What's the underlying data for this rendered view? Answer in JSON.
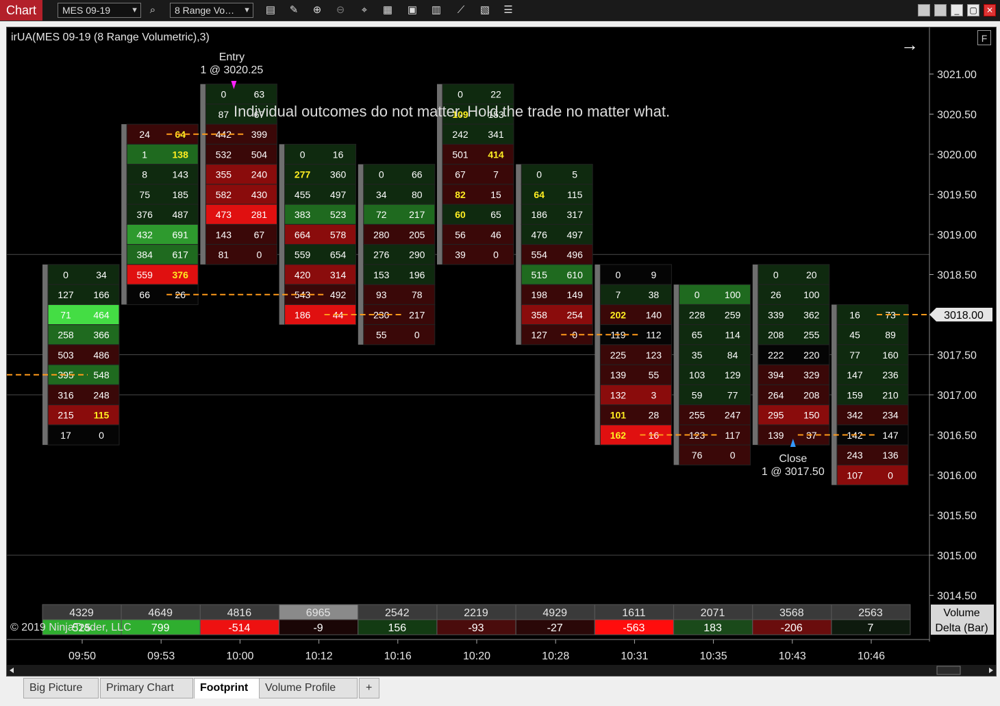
{
  "app": {
    "tab_label": "Chart"
  },
  "toolbar": {
    "instrument": "MES 09-19",
    "bar_type": "8 Range Vo…",
    "icons": [
      "search-icon",
      "data-series-icon",
      "drawing-tools-icon",
      "zoom-in-icon",
      "zoom-out-icon",
      "crosshair-icon",
      "data-box-icon",
      "properties-icon",
      "indicators-icon",
      "strategies-icon",
      "templates-icon",
      "list-icon"
    ]
  },
  "window": {
    "minimize": "_",
    "restore": "▢",
    "close": "✕"
  },
  "chart": {
    "title": "irUA(MES 09-19 (8 Range Volumetric),3)",
    "f_button": "F",
    "message": "Individual outcomes do not matter. Hold the trade no matter what.",
    "copyright": "© 2019 NinjaTrader, LLC",
    "entry_label": [
      "Entry",
      "1 @ 3020.25"
    ],
    "close_label": [
      "Close",
      "1 @ 3017.50"
    ],
    "nav_arrow": "→"
  },
  "colors": {
    "bg": "#000000",
    "grid": "#3a3a3a",
    "text": "#ffffff",
    "highlight_text": "#ffee22",
    "poc_line": "#ff9a1a",
    "entry_marker": "#ff22ff",
    "close_marker": "#3399ff",
    "bar_frame": "#6e6e6e"
  },
  "chart_data": {
    "type": "table",
    "price_axis": {
      "labels": [
        "3021.00",
        "3020.50",
        "3020.00",
        "3019.50",
        "3019.00",
        "3018.50",
        "3018.00",
        "3017.50",
        "3017.00",
        "3016.50",
        "3016.00",
        "3015.50",
        "3015.00",
        "3014.50"
      ],
      "tick": 0.25,
      "current_price": "3018.00"
    },
    "time_axis": [
      "09:50",
      "09:53",
      "10:00",
      "10:12",
      "10:16",
      "10:20",
      "10:28",
      "10:31",
      "10:35",
      "10:43",
      "10:46"
    ],
    "bars": [
      {
        "time": "09:50",
        "top": 3018.5,
        "poc": 3017.25,
        "cells": [
          [
            "0",
            "34"
          ],
          [
            "127",
            "166"
          ],
          [
            "71",
            "464"
          ],
          [
            "258",
            "366"
          ],
          [
            "503",
            "486"
          ],
          [
            "395",
            "548"
          ],
          [
            "316",
            "248"
          ],
          [
            "215",
            "115"
          ],
          [
            "17",
            "0"
          ]
        ],
        "colors": [
          "dg",
          "dg",
          "bg",
          "g",
          "dr",
          "g",
          "dr",
          "r",
          "bk"
        ],
        "yellow": [
          [
            7,
            1
          ]
        ]
      },
      {
        "time": "09:53",
        "top": 3020.25,
        "poc": 3020.25,
        "cells": [
          [
            "24",
            "64"
          ],
          [
            "1",
            "138"
          ],
          [
            "8",
            "143"
          ],
          [
            "75",
            "185"
          ],
          [
            "376",
            "487"
          ],
          [
            "432",
            "691"
          ],
          [
            "384",
            "617"
          ],
          [
            "559",
            "376"
          ],
          [
            "66",
            "26"
          ]
        ],
        "colors": [
          "dr",
          "g",
          "dg",
          "dg",
          "dg",
          "mg",
          "g",
          "br",
          "bk"
        ],
        "yellow": [
          [
            0,
            1
          ],
          [
            1,
            1
          ],
          [
            7,
            1
          ]
        ]
      },
      {
        "time": "10:00",
        "top": 3020.75,
        "poc": 3020.25,
        "cells": [
          [
            "0",
            "63"
          ],
          [
            "87",
            "67"
          ],
          [
            "442",
            "399"
          ],
          [
            "532",
            "504"
          ],
          [
            "355",
            "240"
          ],
          [
            "582",
            "430"
          ],
          [
            "473",
            "281"
          ],
          [
            "143",
            "67"
          ],
          [
            "81",
            "0"
          ]
        ],
        "colors": [
          "dg",
          "dg",
          "dr",
          "dr",
          "r",
          "r",
          "br",
          "dr",
          "dr"
        ],
        "yellow": []
      },
      {
        "time": "10:12",
        "top": 3020.0,
        "poc": 3018.25,
        "cells": [
          [
            "0",
            "16"
          ],
          [
            "277",
            "360"
          ],
          [
            "455",
            "497"
          ],
          [
            "383",
            "523"
          ],
          [
            "664",
            "578"
          ],
          [
            "559",
            "654"
          ],
          [
            "420",
            "314"
          ],
          [
            "543",
            "492"
          ],
          [
            "186",
            "44"
          ]
        ],
        "colors": [
          "dg",
          "dg",
          "dg",
          "g",
          "r",
          "dg",
          "r",
          "dr",
          "br"
        ],
        "yellow": [
          [
            1,
            0
          ]
        ]
      },
      {
        "time": "10:16",
        "top": 3019.75,
        "poc": 3018.0,
        "cells": [
          [
            "0",
            "66"
          ],
          [
            "34",
            "80"
          ],
          [
            "72",
            "217"
          ],
          [
            "280",
            "205"
          ],
          [
            "276",
            "290"
          ],
          [
            "153",
            "196"
          ],
          [
            "93",
            "78"
          ],
          [
            "230",
            "217"
          ],
          [
            "55",
            "0"
          ]
        ],
        "colors": [
          "dg",
          "dg",
          "g",
          "dr",
          "dg",
          "dg",
          "dr",
          "dr",
          "dr"
        ],
        "yellow": []
      },
      {
        "time": "10:20",
        "top": 3020.75,
        "poc": 3020.5,
        "cells": [
          [
            "0",
            "22"
          ],
          [
            "109",
            "153"
          ],
          [
            "242",
            "341"
          ],
          [
            "501",
            "414"
          ],
          [
            "67",
            "7"
          ],
          [
            "82",
            "15"
          ],
          [
            "60",
            "65"
          ],
          [
            "56",
            "46"
          ],
          [
            "39",
            "0"
          ]
        ],
        "colors": [
          "dg",
          "dg",
          "dg",
          "dr",
          "dr",
          "dr",
          "dg",
          "dr",
          "dr"
        ],
        "yellow": [
          [
            1,
            0
          ],
          [
            3,
            1
          ],
          [
            5,
            0
          ],
          [
            6,
            0
          ]
        ]
      },
      {
        "time": "10:28",
        "top": 3019.75,
        "poc": 3017.75,
        "cells": [
          [
            "0",
            "5"
          ],
          [
            "64",
            "115"
          ],
          [
            "186",
            "317"
          ],
          [
            "476",
            "497"
          ],
          [
            "554",
            "496"
          ],
          [
            "515",
            "610"
          ],
          [
            "198",
            "149"
          ],
          [
            "358",
            "254"
          ],
          [
            "127",
            "0"
          ]
        ],
        "colors": [
          "dg",
          "dg",
          "dg",
          "dg",
          "dr",
          "g",
          "dr",
          "r",
          "dr"
        ],
        "yellow": [
          [
            1,
            0
          ]
        ]
      },
      {
        "time": "10:31",
        "top": 3018.5,
        "poc": 3016.5,
        "cells": [
          [
            "0",
            "9"
          ],
          [
            "7",
            "38"
          ],
          [
            "202",
            "140"
          ],
          [
            "119",
            "112"
          ],
          [
            "225",
            "123"
          ],
          [
            "139",
            "55"
          ],
          [
            "132",
            "3"
          ],
          [
            "101",
            "28"
          ],
          [
            "162",
            "16"
          ]
        ],
        "colors": [
          "bk",
          "dg",
          "dr",
          "bk",
          "dr",
          "dr",
          "r",
          "dr",
          "br"
        ],
        "yellow": [
          [
            2,
            0
          ],
          [
            7,
            0
          ],
          [
            8,
            0
          ]
        ]
      },
      {
        "time": "10:35",
        "top": 3018.25,
        "poc": 3016.5,
        "cells": [
          [
            "0",
            "100"
          ],
          [
            "228",
            "259"
          ],
          [
            "65",
            "114"
          ],
          [
            "35",
            "84"
          ],
          [
            "103",
            "129"
          ],
          [
            "59",
            "77"
          ],
          [
            "255",
            "247"
          ],
          [
            "123",
            "117"
          ],
          [
            "76",
            "0"
          ]
        ],
        "colors": [
          "g",
          "dg",
          "dg",
          "dg",
          "dg",
          "dg",
          "dr",
          "dr",
          "dr"
        ],
        "yellow": []
      },
      {
        "time": "10:43",
        "top": 3018.5,
        "poc": 3016.5,
        "cells": [
          [
            "0",
            "20"
          ],
          [
            "26",
            "100"
          ],
          [
            "339",
            "362"
          ],
          [
            "208",
            "255"
          ],
          [
            "222",
            "220"
          ],
          [
            "394",
            "329"
          ],
          [
            "264",
            "208"
          ],
          [
            "295",
            "150"
          ],
          [
            "139",
            "37"
          ]
        ],
        "colors": [
          "dg",
          "dg",
          "dg",
          "dg",
          "bk",
          "dr",
          "dr",
          "r",
          "dr"
        ],
        "yellow": []
      },
      {
        "time": "10:46",
        "top": 3018.0,
        "poc": 3018.0,
        "cells": [
          [
            "16",
            "73"
          ],
          [
            "45",
            "89"
          ],
          [
            "77",
            "160"
          ],
          [
            "147",
            "236"
          ],
          [
            "159",
            "210"
          ],
          [
            "342",
            "234"
          ],
          [
            "142",
            "147"
          ],
          [
            "243",
            "136"
          ],
          [
            "107",
            "0"
          ]
        ],
        "colors": [
          "dg",
          "dg",
          "dg",
          "dg",
          "dg",
          "dr",
          "bk",
          "dr",
          "r"
        ],
        "yellow": []
      }
    ],
    "poc_lines": [
      {
        "price": 3017.25,
        "from": -1,
        "to": 0
      },
      {
        "price": 3020.25,
        "from": 1,
        "to": 2
      },
      {
        "price": 3018.25,
        "from": 1,
        "to": 3
      },
      {
        "price": 3018.0,
        "from": 3,
        "to": 4
      },
      {
        "price": 3017.75,
        "from": 6,
        "to": 7
      },
      {
        "price": 3016.5,
        "from": 7,
        "to": 8
      },
      {
        "price": 3016.5,
        "from": 9,
        "to": 10
      },
      {
        "price": 3018.0,
        "from": 10,
        "to": 11
      }
    ],
    "summary": {
      "row_labels": [
        "Volume",
        "Delta (Bar)"
      ],
      "volume": [
        "4329",
        "4649",
        "4816",
        "6965",
        "2542",
        "2219",
        "4929",
        "1611",
        "2071",
        "3568",
        "2563"
      ],
      "delta": [
        "525",
        "799",
        "-514",
        "-9",
        "156",
        "-93",
        "-27",
        "-563",
        "183",
        "-206",
        "7"
      ],
      "volume_colors": [
        "#3a3a3a",
        "#3a3a3a",
        "#3a3a3a",
        "#8a8a8a",
        "#3a3a3a",
        "#3a3a3a",
        "#3a3a3a",
        "#3a3a3a",
        "#3a3a3a",
        "#3a3a3a",
        "#3a3a3a"
      ],
      "delta_colors": [
        "#2fae2f",
        "#2fae2f",
        "#ee1111",
        "#1a0606",
        "#133b13",
        "#4a0c0c",
        "#2a0808",
        "#ff0d0d",
        "#1a4a1a",
        "#6a0d0d",
        "#0e1a0e"
      ]
    }
  },
  "tabs": [
    {
      "label": "Big Picture",
      "active": false
    },
    {
      "label": "Primary Chart",
      "active": false
    },
    {
      "label": "Footprint",
      "active": true
    },
    {
      "label": "Volume Profile",
      "active": false
    }
  ],
  "add_tab": "+"
}
